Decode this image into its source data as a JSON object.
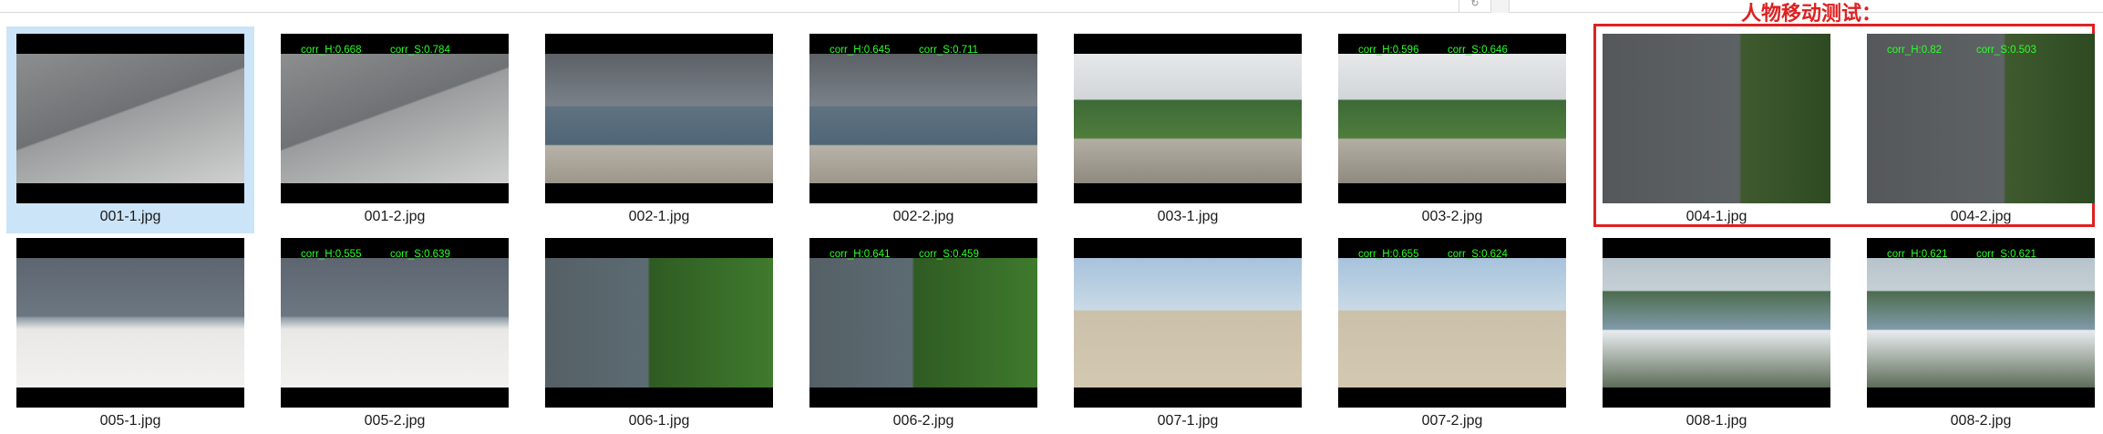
{
  "annotation": {
    "text": "人物移动测试：",
    "color": "#e02020"
  },
  "topbar": {
    "refresh_icon": "refresh-icon"
  },
  "rows": [
    [
      {
        "file": "001-1.jpg",
        "scene": "s1",
        "selected": true,
        "overlay": null
      },
      {
        "file": "001-2.jpg",
        "scene": "s1",
        "selected": false,
        "overlay": {
          "h": "corr_H:0.668",
          "s": "corr_S:0.784"
        }
      },
      {
        "file": "002-1.jpg",
        "scene": "s2",
        "selected": false,
        "overlay": null
      },
      {
        "file": "002-2.jpg",
        "scene": "s2",
        "selected": false,
        "overlay": {
          "h": "corr_H:0.645",
          "s": "corr_S:0.711"
        }
      },
      {
        "file": "003-1.jpg",
        "scene": "s3",
        "selected": false,
        "overlay": null
      },
      {
        "file": "003-2.jpg",
        "scene": "s3",
        "selected": false,
        "overlay": {
          "h": "corr_H:0.596",
          "s": "corr_S:0.646"
        }
      },
      {
        "file": "004-1.jpg",
        "scene": "s4",
        "selected": false,
        "overlay": null
      },
      {
        "file": "004-2.jpg",
        "scene": "s4",
        "selected": false,
        "overlay": {
          "h": "corr_H:0.82",
          "s": "corr_S:0.503"
        }
      }
    ],
    [
      {
        "file": "005-1.jpg",
        "scene": "s5",
        "selected": false,
        "overlay": null
      },
      {
        "file": "005-2.jpg",
        "scene": "s5",
        "selected": false,
        "overlay": {
          "h": "corr_H:0.555",
          "s": "corr_S:0.639"
        }
      },
      {
        "file": "006-1.jpg",
        "scene": "s6",
        "selected": false,
        "overlay": null
      },
      {
        "file": "006-2.jpg",
        "scene": "s6",
        "selected": false,
        "overlay": {
          "h": "corr_H:0.641",
          "s": "corr_S:0.459"
        }
      },
      {
        "file": "007-1.jpg",
        "scene": "s7",
        "selected": false,
        "overlay": null
      },
      {
        "file": "007-2.jpg",
        "scene": "s7",
        "selected": false,
        "overlay": {
          "h": "corr_H:0.655",
          "s": "corr_S:0.624"
        }
      },
      {
        "file": "008-1.jpg",
        "scene": "s8",
        "selected": false,
        "overlay": null
      },
      {
        "file": "008-2.jpg",
        "scene": "s8",
        "selected": false,
        "overlay": {
          "h": "corr_H:0.621",
          "s": "corr_S:0.621"
        }
      }
    ]
  ]
}
